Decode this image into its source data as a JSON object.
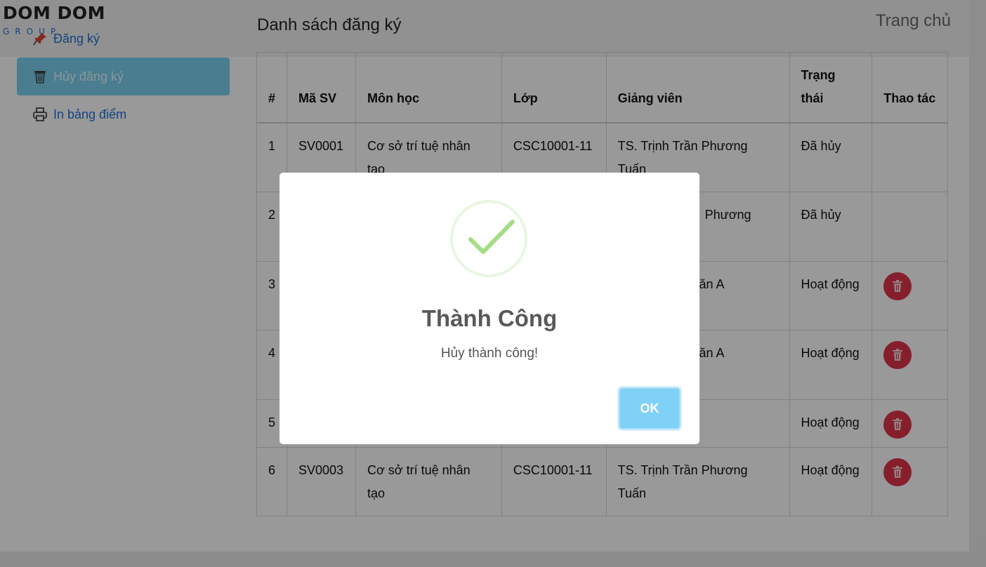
{
  "brand": {
    "title": "DOM DOM",
    "subtitle": "GROUP"
  },
  "header": {
    "home_link": "Trang chủ"
  },
  "sidebar": {
    "items": [
      {
        "label": "Đăng ký",
        "icon": "pushpin-icon"
      },
      {
        "label": "Hủy đăng ký",
        "icon": "trash-icon",
        "active": true
      },
      {
        "label": "In bảng điểm",
        "icon": "printer-icon"
      }
    ]
  },
  "main": {
    "title": "Danh sách đăng ký",
    "table": {
      "headers": [
        "#",
        "Mã SV",
        "Môn học",
        "Lớp",
        "Giảng viên",
        "Trạng thái",
        "Thao tác"
      ],
      "rows": [
        {
          "no": "1",
          "student_id": "SV0001",
          "course": "Cơ sở trí tuệ nhân tạo",
          "class": "CSC10001-11",
          "lecturer": "TS. Trịnh Trần Phương Tuấn",
          "status": "Đã hủy",
          "has_action": false
        },
        {
          "no": "2",
          "student_id": "",
          "course": "",
          "class": "",
          "lecturer": "Phương",
          "status": "Đã hủy",
          "has_action": false
        },
        {
          "no": "3",
          "student_id": "",
          "course": "",
          "class": "",
          "lecturer": "ăn A",
          "status": "Hoạt động",
          "has_action": true
        },
        {
          "no": "4",
          "student_id": "",
          "course": "",
          "class": "",
          "lecturer": "ăn A",
          "status": "Hoạt động",
          "has_action": true
        },
        {
          "no": "5",
          "student_id": "",
          "course": "",
          "class": "",
          "lecturer": "",
          "status": "Hoạt động",
          "has_action": true
        },
        {
          "no": "6",
          "student_id": "SV0003",
          "course": "Cơ sở trí tuệ nhân tạo",
          "class": "CSC10001-11",
          "lecturer": "TS. Trịnh Trần Phương Tuấn",
          "status": "Hoạt động",
          "has_action": true
        }
      ]
    }
  },
  "modal": {
    "icon": "success-check-icon",
    "title": "Thành Công",
    "text": "Hủy thành công!",
    "ok_label": "OK"
  },
  "colors": {
    "accent": "#1e72d6",
    "active_sidebar": "#7ad0ee",
    "delete_button": "#e0354a",
    "ok_button": "#7fd1f7",
    "success": "#a5dc86"
  }
}
